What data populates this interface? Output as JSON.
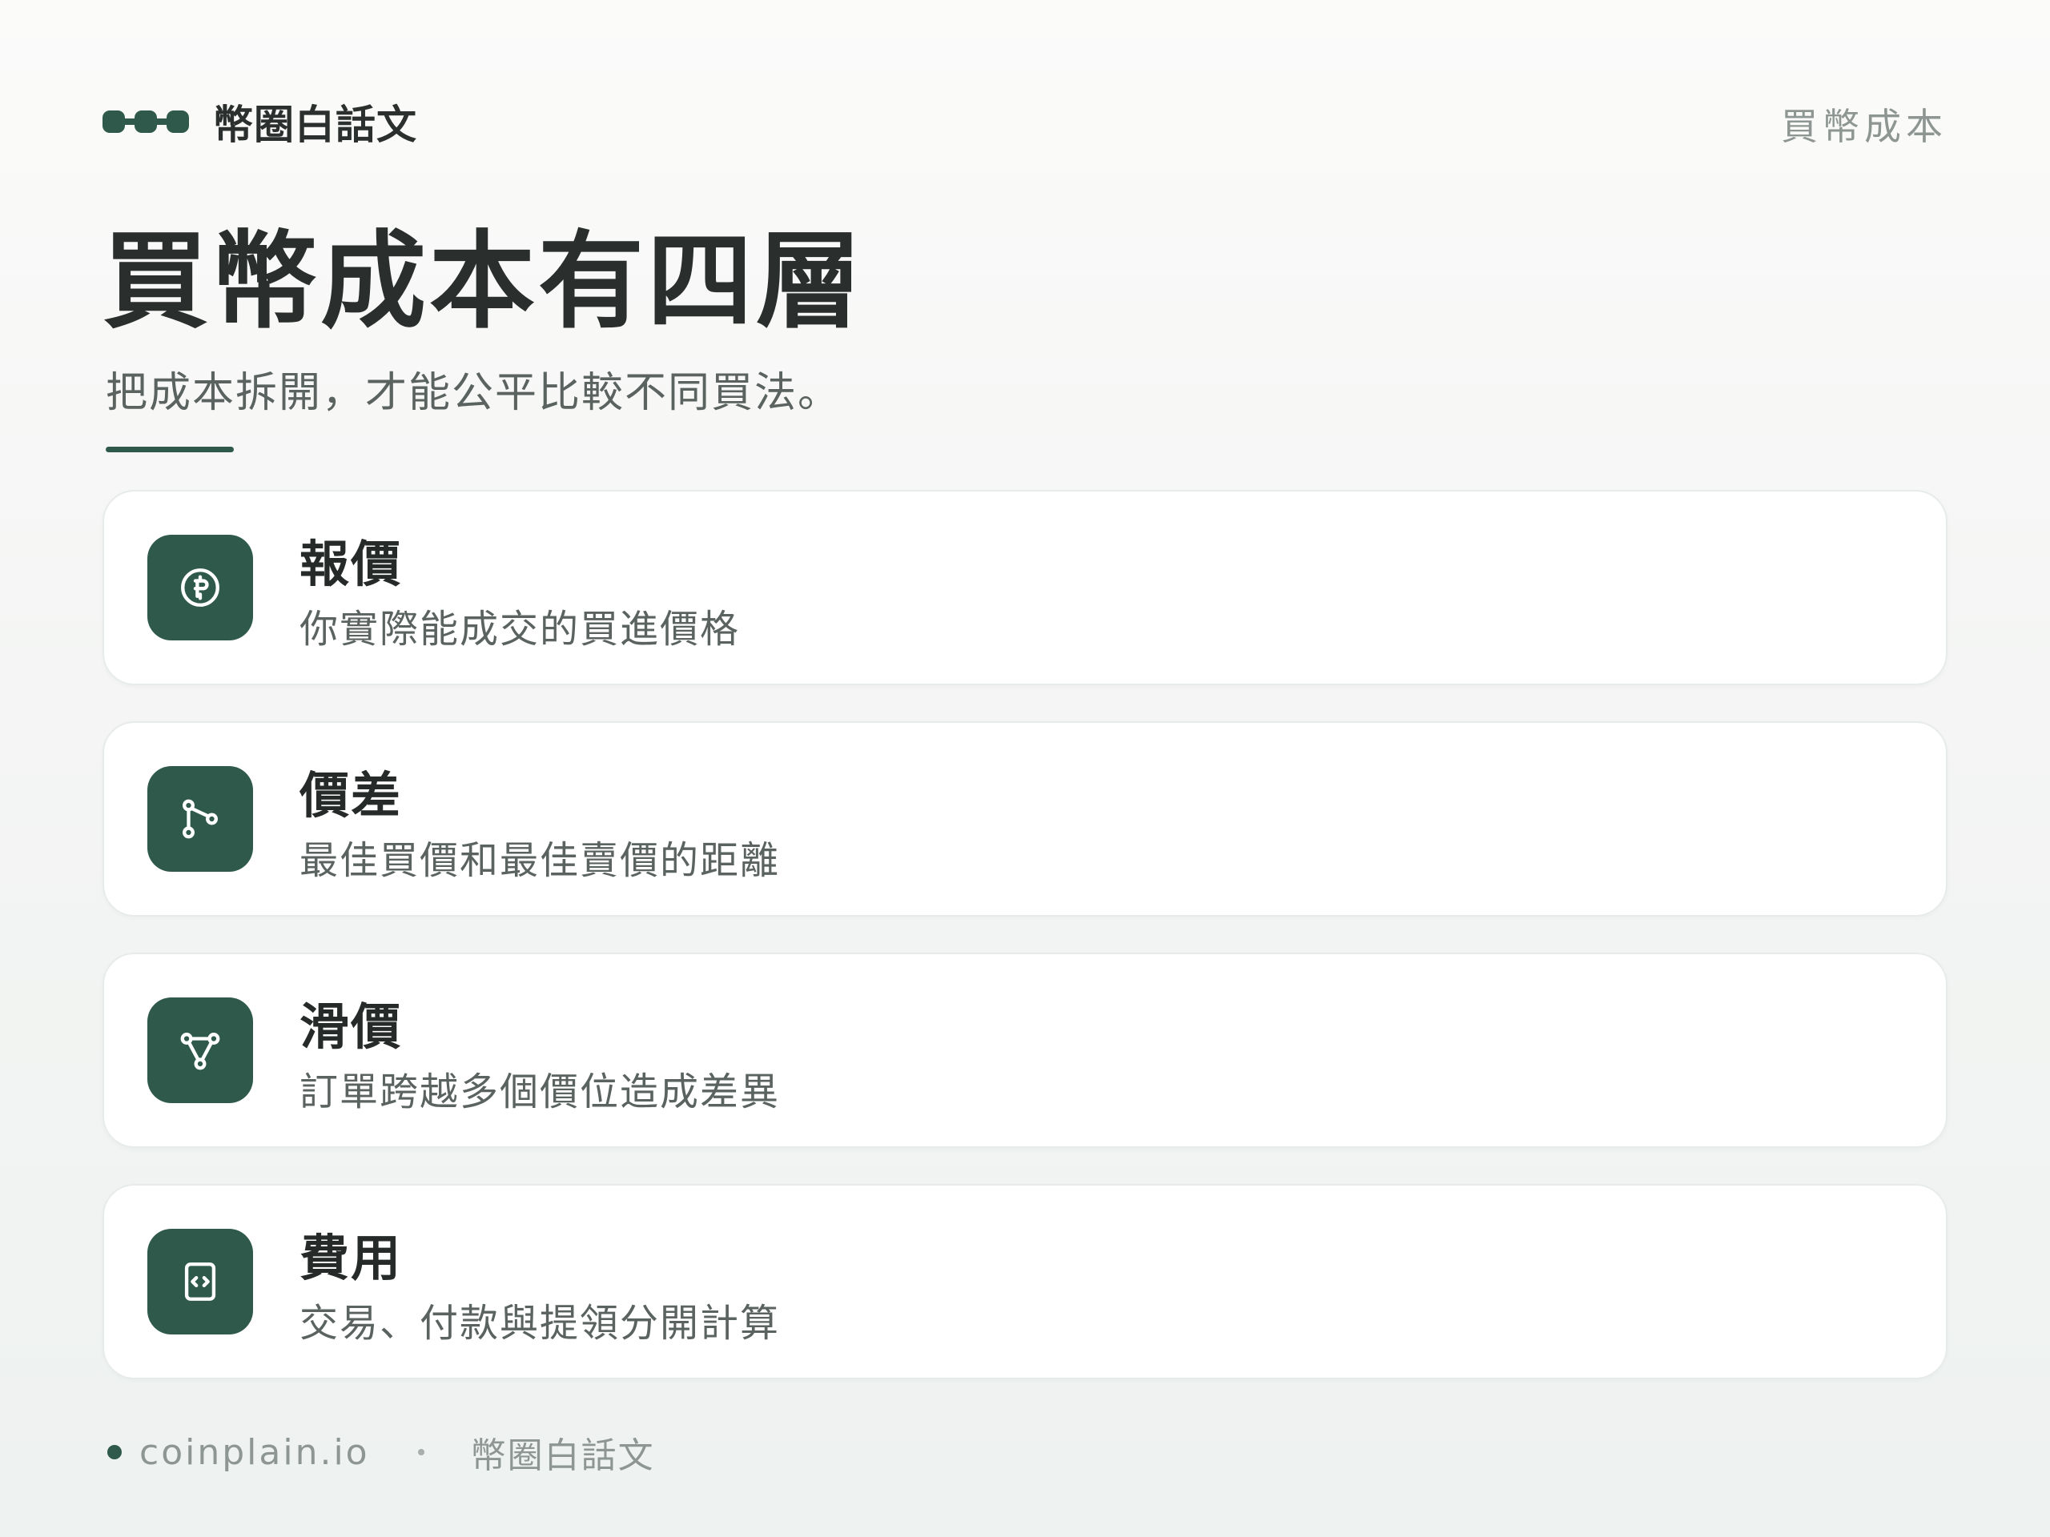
{
  "header": {
    "brand_name": "幣圈白話文",
    "top_tag": "買幣成本"
  },
  "title": "買幣成本有四層",
  "subtitle": "把成本拆開，才能公平比較不同買法。",
  "cards": [
    {
      "title": "報價",
      "desc": "你實際能成交的買進價格",
      "icon": "coin-icon"
    },
    {
      "title": "價差",
      "desc": "最佳買價和最佳賣價的距離",
      "icon": "git-branch-icon"
    },
    {
      "title": "滑價",
      "desc": "訂單跨越多個價位造成差異",
      "icon": "network-icon"
    },
    {
      "title": "費用",
      "desc": "交易、付款與提領分開計算",
      "icon": "code-file-icon"
    }
  ],
  "footer": {
    "domain": "coinplain.io",
    "brand": "幣圈白話文"
  },
  "colors": {
    "accent": "#2f5a4b",
    "text": "#2a2e2c",
    "muted": "#8d9692"
  }
}
